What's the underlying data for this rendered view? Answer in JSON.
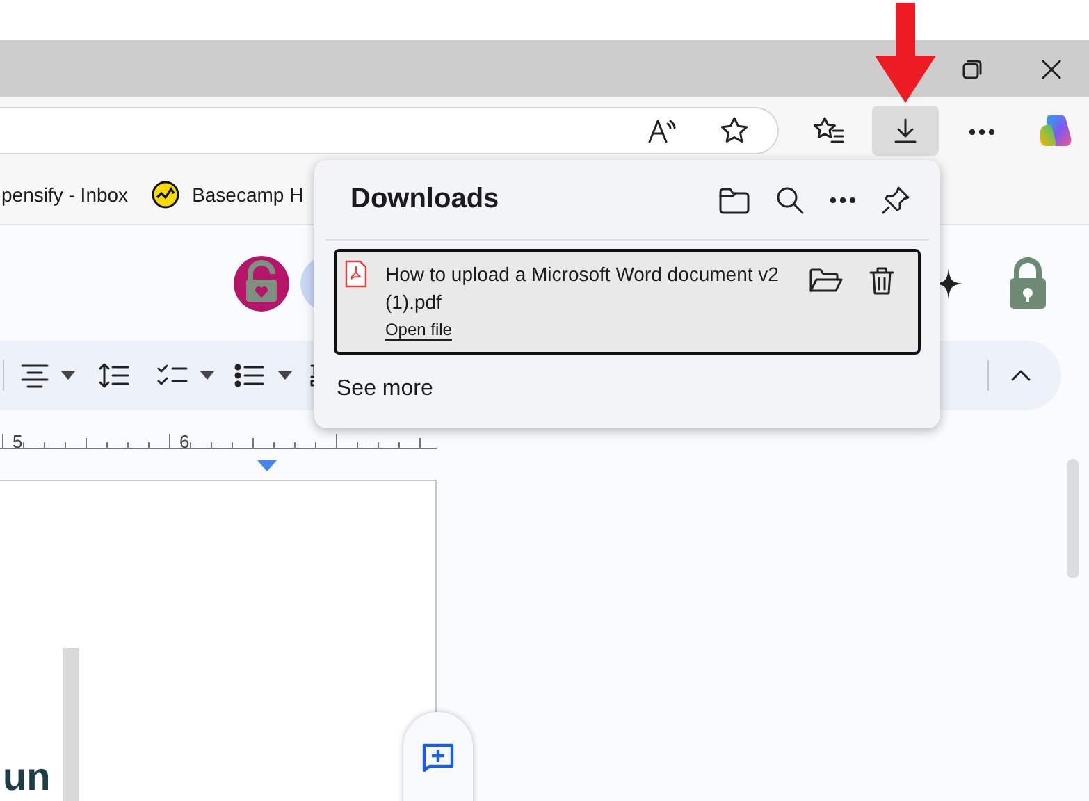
{
  "toolbar": {
    "download_button": {
      "pressed": true
    }
  },
  "bookmarks": [
    {
      "label": "pensify - Inbox"
    },
    {
      "label": "Basecamp H"
    }
  ],
  "ruler": {
    "numbers": [
      "5",
      "6"
    ]
  },
  "document": {
    "visible_text": "un"
  },
  "downloads": {
    "title": "Downloads",
    "items": [
      {
        "name": "How to upload a Microsoft Word document v2 (1).pdf",
        "link": "Open file",
        "focused": true
      }
    ],
    "see_more": "See more"
  }
}
